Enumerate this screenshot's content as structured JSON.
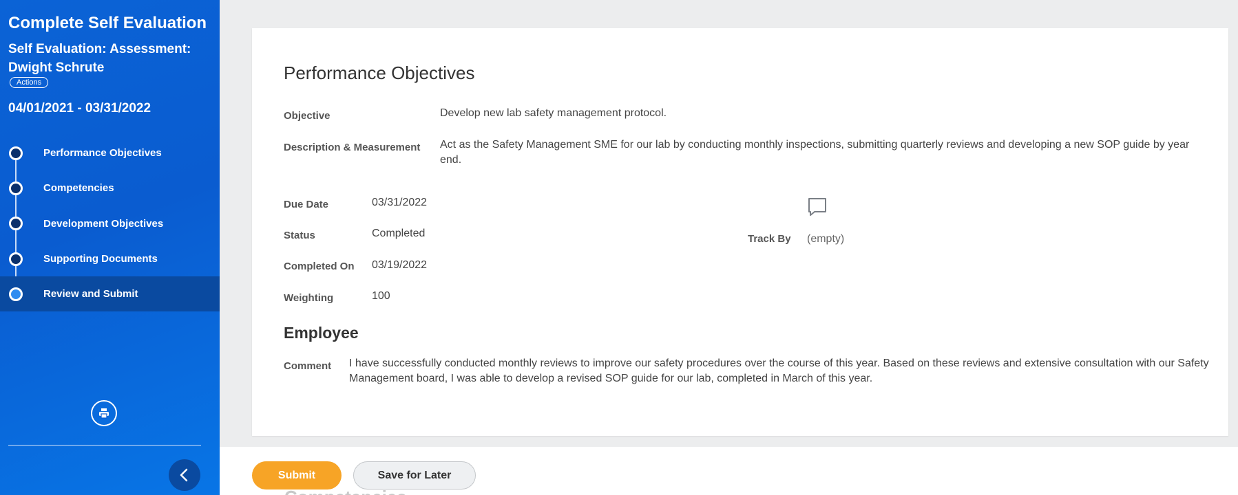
{
  "sidebar": {
    "title": "Complete Self Evaluation",
    "subtitle": "Self Evaluation: Assessment: Dwight Schrute",
    "actions_label": "Actions",
    "date_range": "04/01/2021 - 03/31/2022",
    "steps": [
      {
        "label": "Performance Objectives"
      },
      {
        "label": "Competencies"
      },
      {
        "label": "Development Objectives"
      },
      {
        "label": "Supporting Documents"
      },
      {
        "label": "Review and Submit"
      }
    ],
    "active_step": "Review and Submit",
    "print_icon": "print-icon",
    "collapse_icon": "chevron-left-icon"
  },
  "card": {
    "title": "Performance Objectives",
    "objective_label": "Objective",
    "objective_value": "Develop new lab safety management protocol.",
    "description_label": "Description & Measurement",
    "description_value": "Act as the Safety Management SME for our lab by conducting monthly inspections, submitting quarterly reviews and developing a new SOP guide by year end.",
    "due_date_label": "Due Date",
    "due_date_value": "03/31/2022",
    "status_label": "Status",
    "status_value": "Completed",
    "completed_on_label": "Completed On",
    "completed_on_value": "03/19/2022",
    "weighting_label": "Weighting",
    "weighting_value": "100",
    "track_by_label": "Track By",
    "track_by_value": "(empty)",
    "comment_icon": "comment-icon",
    "employee_heading": "Employee",
    "comment_label": "Comment",
    "comment_value": "I have successfully conducted monthly reviews to improve our safety procedures over the course of this year. Based on these reviews and extensive consultation with our Safety Management board, I was able to develop a revised SOP guide for our lab, completed in March of this year."
  },
  "footer": {
    "submit_label": "Submit",
    "save_label": "Save for Later",
    "ghost_heading": "Competencies"
  },
  "colors": {
    "sidebar_blue": "#0b63d6",
    "active_step": "#0a4aa0",
    "submit_orange": "#f7a426"
  }
}
